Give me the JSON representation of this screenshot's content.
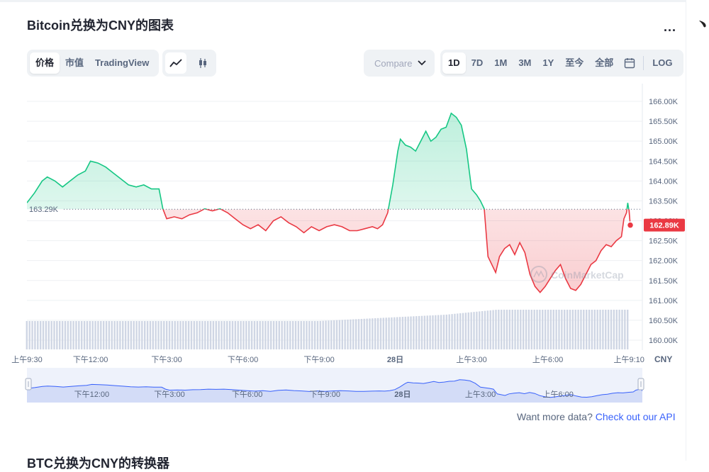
{
  "title": "Bitcoin兑换为CNY的图表",
  "more_label": "...",
  "tabs": [
    "价格",
    "市值",
    "TradingView"
  ],
  "compare_placeholder": "Compare with",
  "ranges": [
    "1D",
    "7D",
    "1M",
    "3M",
    "1Y",
    "至今",
    "全部"
  ],
  "log_label": "LOG",
  "api": {
    "text": "Want more data?",
    "link": "Check out our API"
  },
  "subheading": "BTC兑换为CNY的转换器",
  "colors": {
    "up": "#16c784",
    "down": "#ea3943",
    "accent": "#3861fb",
    "volume": "#cfd6e4"
  },
  "icons": [
    "line-chart-icon",
    "candlestick-icon",
    "chevron-down-icon",
    "calendar-icon",
    "coinmarketcap-logo"
  ],
  "chart_data": {
    "type": "line",
    "currency": "CNY",
    "watermark": "CoinMarketCap",
    "open_price": 163290,
    "open_label": "163.29K",
    "last_price": 162890,
    "last_label": "162.89K",
    "ylim": [
      159850,
      166250
    ],
    "y_ticks": [
      "166.00K",
      "165.50K",
      "165.00K",
      "164.50K",
      "164.00K",
      "163.50K",
      "163.00K",
      "162.50K",
      "162.00K",
      "161.50K",
      "161.00K",
      "160.50K",
      "160.00K"
    ],
    "y_tick_values": [
      166000,
      165500,
      165000,
      164500,
      164000,
      163500,
      163000,
      162500,
      162000,
      161500,
      161000,
      160500,
      160000
    ],
    "x_range_hours": [
      9.5,
      33.25
    ],
    "x_tick_labels": [
      "上午9:30",
      "下午12:00",
      "下午3:00",
      "下午6:00",
      "下午9:00",
      "28日",
      "上午3:00",
      "上午6:00",
      "上午9:10"
    ],
    "x_tick_hours": [
      9.5,
      12,
      15,
      18,
      21,
      24,
      27,
      30,
      33.2
    ],
    "nav_tick_labels": [
      "下午12:00",
      "下午3:00",
      "下午6:00",
      "下午9:00",
      "28日",
      "上午3:00",
      "上午6:00"
    ],
    "nav_tick_hours": [
      12,
      15,
      18,
      21,
      24,
      27,
      30
    ],
    "price_points": [
      [
        9.5,
        163450
      ],
      [
        9.8,
        163700
      ],
      [
        10.1,
        164000
      ],
      [
        10.3,
        164100
      ],
      [
        10.6,
        164000
      ],
      [
        10.9,
        163850
      ],
      [
        11.2,
        164000
      ],
      [
        11.5,
        164150
      ],
      [
        11.8,
        164250
      ],
      [
        12.0,
        164500
      ],
      [
        12.3,
        164450
      ],
      [
        12.6,
        164350
      ],
      [
        12.9,
        164200
      ],
      [
        13.2,
        164050
      ],
      [
        13.5,
        163900
      ],
      [
        13.8,
        163850
      ],
      [
        14.1,
        163900
      ],
      [
        14.4,
        163800
      ],
      [
        14.7,
        163800
      ],
      [
        14.85,
        163300
      ],
      [
        15.0,
        163050
      ],
      [
        15.3,
        163100
      ],
      [
        15.6,
        163050
      ],
      [
        15.9,
        163150
      ],
      [
        16.2,
        163200
      ],
      [
        16.5,
        163300
      ],
      [
        16.8,
        163250
      ],
      [
        17.1,
        163300
      ],
      [
        17.4,
        163200
      ],
      [
        17.7,
        163050
      ],
      [
        18.0,
        162900
      ],
      [
        18.3,
        162800
      ],
      [
        18.6,
        162900
      ],
      [
        18.9,
        162750
      ],
      [
        19.2,
        163000
      ],
      [
        19.5,
        163100
      ],
      [
        19.8,
        162950
      ],
      [
        20.1,
        162850
      ],
      [
        20.4,
        162700
      ],
      [
        20.7,
        162850
      ],
      [
        21.0,
        162750
      ],
      [
        21.3,
        162850
      ],
      [
        21.6,
        162900
      ],
      [
        21.9,
        162850
      ],
      [
        22.2,
        162750
      ],
      [
        22.5,
        162750
      ],
      [
        22.8,
        162800
      ],
      [
        23.1,
        162850
      ],
      [
        23.3,
        162800
      ],
      [
        23.5,
        162900
      ],
      [
        23.7,
        163200
      ],
      [
        23.9,
        163900
      ],
      [
        24.1,
        164750
      ],
      [
        24.2,
        165050
      ],
      [
        24.4,
        164900
      ],
      [
        24.6,
        164850
      ],
      [
        24.8,
        164750
      ],
      [
        25.0,
        165000
      ],
      [
        25.2,
        165250
      ],
      [
        25.4,
        165000
      ],
      [
        25.6,
        165100
      ],
      [
        25.8,
        165300
      ],
      [
        26.0,
        165350
      ],
      [
        26.2,
        165700
      ],
      [
        26.4,
        165600
      ],
      [
        26.6,
        165400
      ],
      [
        26.8,
        164800
      ],
      [
        27.0,
        163800
      ],
      [
        27.2,
        163650
      ],
      [
        27.35,
        163500
      ],
      [
        27.5,
        163300
      ],
      [
        27.65,
        162100
      ],
      [
        27.8,
        161900
      ],
      [
        27.95,
        161700
      ],
      [
        28.1,
        162100
      ],
      [
        28.3,
        162300
      ],
      [
        28.5,
        162400
      ],
      [
        28.7,
        162150
      ],
      [
        28.9,
        162450
      ],
      [
        29.1,
        162200
      ],
      [
        29.3,
        161650
      ],
      [
        29.5,
        161350
      ],
      [
        29.7,
        161200
      ],
      [
        29.9,
        161350
      ],
      [
        30.1,
        161550
      ],
      [
        30.3,
        161750
      ],
      [
        30.5,
        161900
      ],
      [
        30.7,
        161550
      ],
      [
        30.9,
        161300
      ],
      [
        31.1,
        161250
      ],
      [
        31.3,
        161400
      ],
      [
        31.5,
        161650
      ],
      [
        31.7,
        161900
      ],
      [
        31.9,
        162000
      ],
      [
        32.1,
        162250
      ],
      [
        32.3,
        162400
      ],
      [
        32.5,
        162350
      ],
      [
        32.7,
        162500
      ],
      [
        32.9,
        162600
      ],
      [
        33.0,
        163050
      ],
      [
        33.1,
        163200
      ],
      [
        33.15,
        163450
      ],
      [
        33.2,
        163250
      ],
      [
        33.25,
        162890
      ]
    ]
  }
}
